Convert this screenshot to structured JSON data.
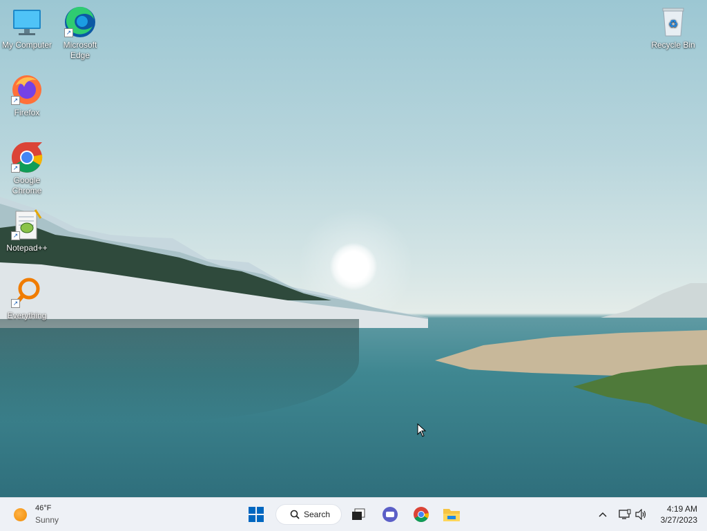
{
  "desktop": {
    "icons": [
      {
        "label": "My Computer"
      },
      {
        "label": "Microsoft Edge"
      },
      {
        "label": "Firefox"
      },
      {
        "label": "Google Chrome"
      },
      {
        "label": "Notepad++"
      },
      {
        "label": "Everything"
      },
      {
        "label": "Recycle Bin"
      }
    ]
  },
  "taskbar": {
    "weather": {
      "temp": "46°F",
      "condition": "Sunny"
    },
    "search_label": "Search",
    "clock": {
      "time": "4:19 AM",
      "date": "3/27/2023"
    },
    "accent": "#0067c0"
  }
}
